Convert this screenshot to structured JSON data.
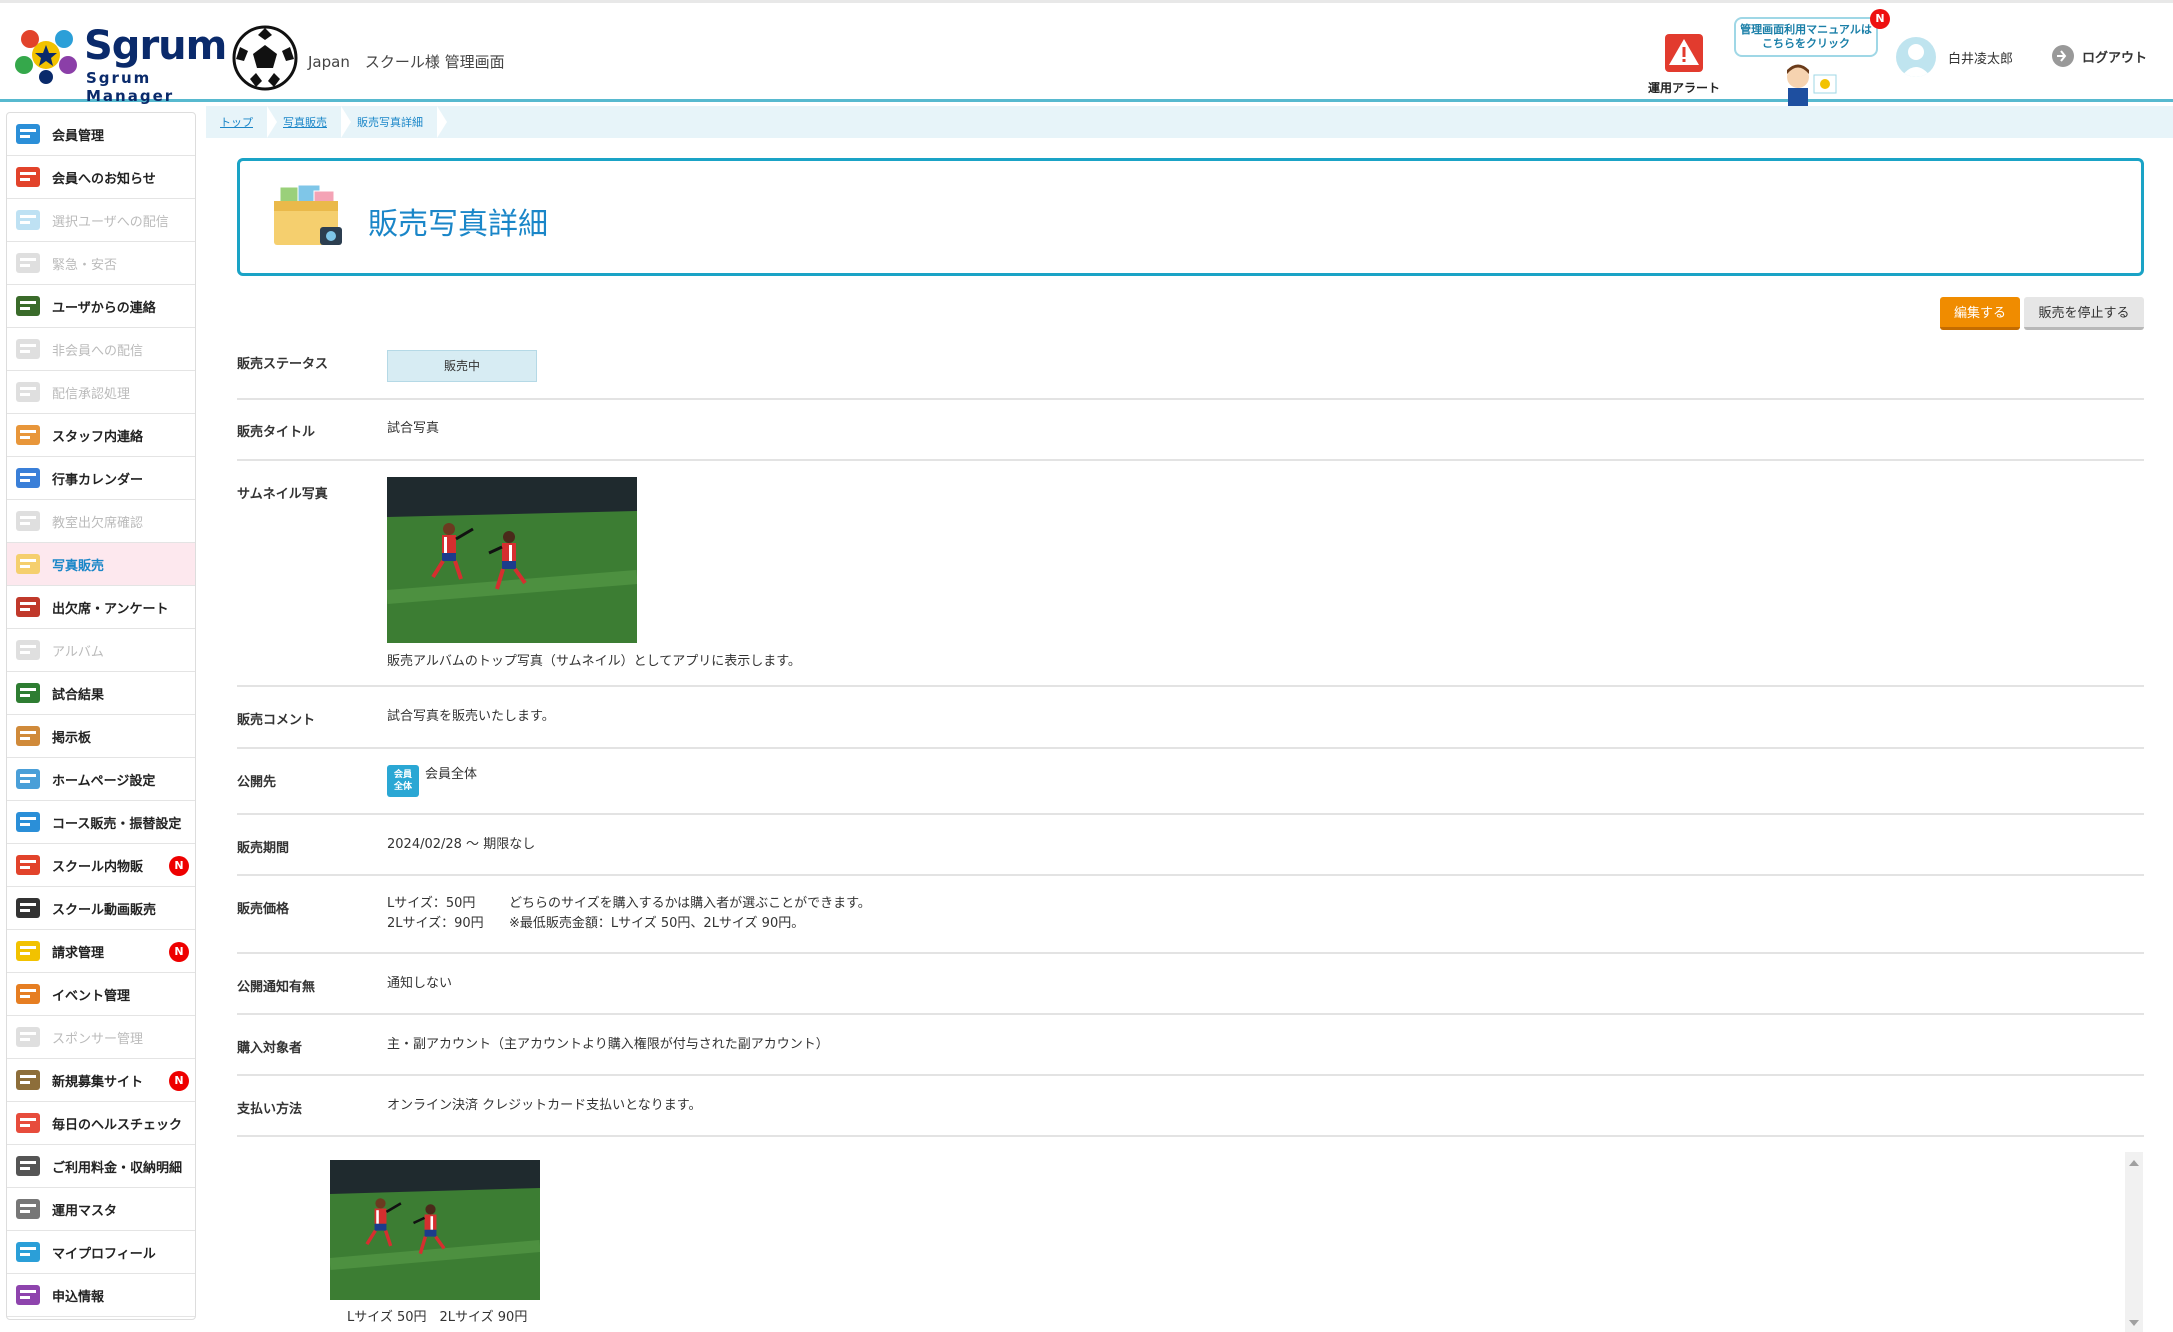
{
  "header": {
    "logo_text": "Sgrum",
    "logo_sub": "Sgrum Manager",
    "school_name": "Japan　スクール様 管理画面",
    "alert_label": "運用アラート",
    "manual_text_1": "管理画面利用マニュアルは",
    "manual_text_2": "こちらをクリック",
    "manual_badge": "N",
    "user_name": "白井凌太郎",
    "logout_label": "ログアウト"
  },
  "sidebar": {
    "items": [
      {
        "label": "会員管理",
        "icon": "members-icon",
        "state": "normal"
      },
      {
        "label": "会員へのお知らせ",
        "icon": "announce-icon",
        "state": "normal"
      },
      {
        "label": "選択ユーザへの配信",
        "icon": "select-delivery-icon",
        "state": "disabled"
      },
      {
        "label": "緊急・安否",
        "icon": "emergency-icon",
        "state": "disabled"
      },
      {
        "label": "ユーザからの連絡",
        "icon": "user-contact-icon",
        "state": "normal"
      },
      {
        "label": "非会員への配信",
        "icon": "nonmember-icon",
        "state": "disabled"
      },
      {
        "label": "配信承認処理",
        "icon": "approval-icon",
        "state": "disabled"
      },
      {
        "label": "スタッフ内連絡",
        "icon": "staff-icon",
        "state": "normal"
      },
      {
        "label": "行事カレンダー",
        "icon": "calendar-icon",
        "state": "normal"
      },
      {
        "label": "教室出欠席確認",
        "icon": "attendance-check-icon",
        "state": "disabled"
      },
      {
        "label": "写真販売",
        "icon": "photo-sale-icon",
        "state": "active"
      },
      {
        "label": "出欠席・アンケート",
        "icon": "survey-icon",
        "state": "normal"
      },
      {
        "label": "アルバム",
        "icon": "album-icon",
        "state": "disabled"
      },
      {
        "label": "試合結果",
        "icon": "scoreboard-icon",
        "state": "normal"
      },
      {
        "label": "掲示板",
        "icon": "board-icon",
        "state": "normal"
      },
      {
        "label": "ホームページ設定",
        "icon": "homepage-icon",
        "state": "normal"
      },
      {
        "label": "コース販売・振替設定",
        "icon": "course-icon",
        "state": "normal"
      },
      {
        "label": "スクール内物販",
        "icon": "cart-icon",
        "state": "normal",
        "badge": "N"
      },
      {
        "label": "スクール動画販売",
        "icon": "video-icon",
        "state": "normal"
      },
      {
        "label": "請求管理",
        "icon": "invoice-icon",
        "state": "normal",
        "badge": "N"
      },
      {
        "label": "イベント管理",
        "icon": "event-icon",
        "state": "normal"
      },
      {
        "label": "スポンサー管理",
        "icon": "sponsor-icon",
        "state": "disabled"
      },
      {
        "label": "新規募集サイト",
        "icon": "recruit-icon",
        "state": "normal",
        "badge": "N"
      },
      {
        "label": "毎日のヘルスチェック",
        "icon": "health-icon",
        "state": "normal"
      },
      {
        "label": "ご利用料金・収納明細",
        "icon": "fee-icon",
        "state": "normal"
      },
      {
        "label": "運用マスタ",
        "icon": "gears-icon",
        "state": "normal"
      },
      {
        "label": "マイプロフィール",
        "icon": "profile-icon",
        "state": "normal"
      },
      {
        "label": "申込情報",
        "icon": "application-icon",
        "state": "normal"
      }
    ]
  },
  "breadcrumb": {
    "items": [
      "トップ",
      "写真販売",
      "販売写真詳細"
    ]
  },
  "page": {
    "title": "販売写真詳細",
    "edit_button": "編集する",
    "stop_button": "販売を停止する"
  },
  "details": {
    "status_label": "販売ステータス",
    "status_value": "販売中",
    "title_label": "販売タイトル",
    "title_value": "試合写真",
    "thumb_label": "サムネイル写真",
    "thumb_note": "販売アルバムのトップ写真（サムネイル）としてアプリに表示します。",
    "comment_label": "販売コメント",
    "comment_value": "試合写真を販売いたします。",
    "publish_label": "公開先",
    "publish_badge_1": "会員",
    "publish_badge_2": "全体",
    "publish_value": "会員全体",
    "period_label": "販売期間",
    "period_value": "2024/02/28 〜 期限なし",
    "price_label": "販売価格",
    "price_l": "Lサイズ：50円",
    "price_note_1": "どちらのサイズを購入するかは購入者が選ぶことができます。",
    "price_2l": "2Lサイズ：90円",
    "price_note_2": "※最低販売金額：Lサイズ 50円、2Lサイズ 90円。",
    "notify_label": "公開通知有無",
    "notify_value": "通知しない",
    "buyer_label": "購入対象者",
    "buyer_value": "主・副アカウント（主アカウントより購入権限が付与された副アカウント）",
    "payment_label": "支払い方法",
    "payment_value": "オンライン決済 クレジットカード支払いとなります。"
  },
  "photos": {
    "caption": "Lサイズ 50円　2Lサイズ 90円"
  },
  "colors": {
    "accent": "#1aa3c6",
    "link": "#1a86c8",
    "edit": "#f08c00",
    "badge": "#e00000"
  }
}
